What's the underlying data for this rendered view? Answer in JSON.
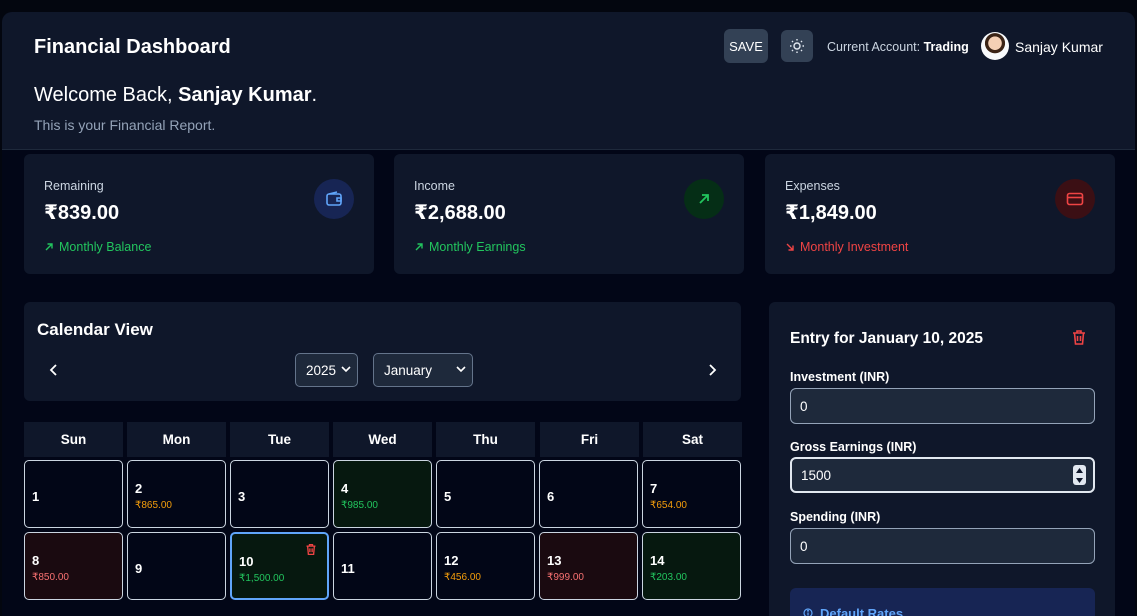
{
  "header": {
    "title": "Financial Dashboard",
    "save_label": "SAVE",
    "account_prefix": "Current Account:",
    "account_name": "Trading",
    "user_name": "Sanjay Kumar",
    "welcome_prefix": "Welcome Back,",
    "welcome_name": "Sanjay Kumar",
    "welcome_suffix": ".",
    "subtitle": "This is your Financial Report."
  },
  "stats": [
    {
      "label": "Remaining",
      "value": "₹839.00",
      "note": "Monthly Balance",
      "icon": "wallet-icon",
      "accent": "#60a5fa"
    },
    {
      "label": "Income",
      "value": "₹2,688.00",
      "note": "Monthly Earnings",
      "icon": "arrow-up-right-icon",
      "accent": "#22c55e"
    },
    {
      "label": "Expenses",
      "value": "₹1,849.00",
      "note": "Monthly Investment",
      "icon": "credit-card-icon",
      "accent": "#ef4444"
    }
  ],
  "calendar": {
    "title": "Calendar View",
    "year": "2025",
    "month": "January",
    "weekdays": [
      "Sun",
      "Mon",
      "Tue",
      "Wed",
      "Thu",
      "Fri",
      "Sat"
    ],
    "days": [
      {
        "day": "1",
        "amount": "",
        "state": "none"
      },
      {
        "day": "2",
        "amount": "₹865.00",
        "state": "amber"
      },
      {
        "day": "3",
        "amount": "",
        "state": "none"
      },
      {
        "day": "4",
        "amount": "₹985.00",
        "state": "green"
      },
      {
        "day": "5",
        "amount": "",
        "state": "none"
      },
      {
        "day": "6",
        "amount": "",
        "state": "none"
      },
      {
        "day": "7",
        "amount": "₹654.00",
        "state": "amber"
      },
      {
        "day": "8",
        "amount": "₹850.00",
        "state": "red"
      },
      {
        "day": "9",
        "amount": "",
        "state": "none"
      },
      {
        "day": "10",
        "amount": "₹1,500.00",
        "state": "selected"
      },
      {
        "day": "11",
        "amount": "",
        "state": "none"
      },
      {
        "day": "12",
        "amount": "₹456.00",
        "state": "amber"
      },
      {
        "day": "13",
        "amount": "₹999.00",
        "state": "red"
      },
      {
        "day": "14",
        "amount": "₹203.00",
        "state": "green"
      }
    ]
  },
  "entry": {
    "title": "Entry for January 10, 2025",
    "investment_label": "Investment (INR)",
    "investment_value": "0",
    "gross_label": "Gross Earnings (INR)",
    "gross_value": "1500",
    "spending_label": "Spending (INR)",
    "spending_value": "0",
    "rates_label": "Default Rates"
  },
  "colors": {
    "green": "#22c55e",
    "red": "#ef4444",
    "amber": "#f59e0b",
    "blue": "#60a5fa",
    "selected_border": "#60a5fa"
  }
}
